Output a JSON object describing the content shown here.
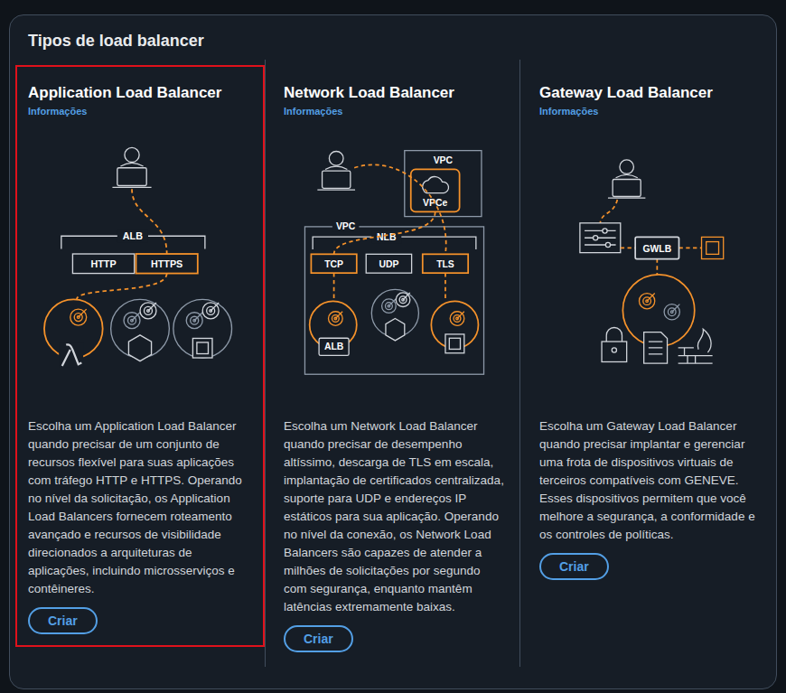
{
  "section": {
    "title": "Tipos de load balancer"
  },
  "cards": [
    {
      "kind": "alb",
      "title": "Application Load Balancer",
      "info_link": "Informações",
      "selected": true,
      "diagram": {
        "group": "ALB",
        "listeners": [
          {
            "label": "HTTP",
            "active": false
          },
          {
            "label": "HTTPS",
            "active": true
          }
        ]
      },
      "description": "Escolha um Application Load Balancer quando precisar de um conjunto de recursos flexível para suas aplicações com tráfego HTTP e HTTPS. Operando no nível da solicitação, os Application Load Balancers fornecem roteamento avançado e recursos de visibilidade direcionados a arquiteturas de aplicações, incluindo microsserviços e contêineres.",
      "button": "Criar"
    },
    {
      "kind": "nlb",
      "title": "Network Load Balancer",
      "info_link": "Informações",
      "selected": false,
      "diagram": {
        "endpoint_vpc": "VPC",
        "endpoint": "VPCe",
        "vpc": "VPC",
        "group": "NLB",
        "listeners": [
          {
            "label": "TCP",
            "active": true
          },
          {
            "label": "UDP",
            "active": false
          },
          {
            "label": "TLS",
            "active": true
          }
        ],
        "target": "ALB"
      },
      "description": "Escolha um Network Load Balancer quando precisar de desempenho altíssimo, descarga de TLS em escala, implantação de certificados centralizada, suporte para UDP e endereços IP estáticos para sua aplicação. Operando no nível da conexão, os Network Load Balancers são capazes de atender a milhões de solicitações por segundo com segurança, enquanto mantêm latências extremamente baixas.",
      "button": "Criar"
    },
    {
      "kind": "gwlb",
      "title": "Gateway Load Balancer",
      "info_link": "Informações",
      "selected": false,
      "diagram": {
        "group": "GWLB"
      },
      "description": "Escolha um Gateway Load Balancer quando precisar implantar e gerenciar uma frota de dispositivos virtuais de terceiros compatíveis com GENEVE. Esses dispositivos permitem que você melhore a segurança, a conformidade e os controles de políticas.",
      "button": "Criar"
    }
  ]
}
